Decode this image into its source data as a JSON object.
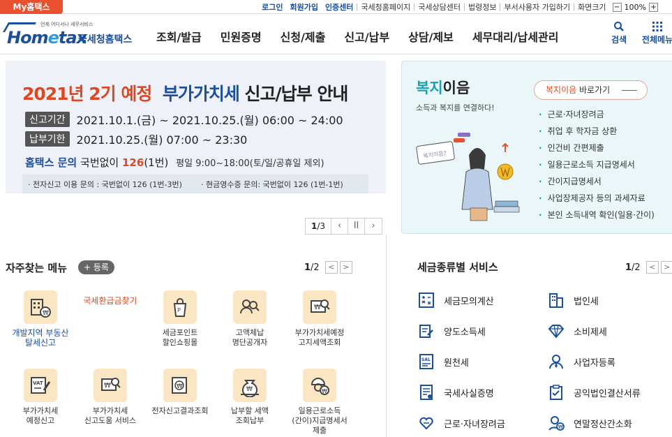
{
  "topbar": {
    "my_tab": "My홈택스",
    "links": [
      "로그인",
      "회원가입",
      "인증센터",
      "국세청홈페이지",
      "국세상담센터",
      "법령정보",
      "부서사용자 가입하기",
      "화면크기"
    ],
    "zoom_minus": "−",
    "zoom_value": "100%",
    "zoom_plus": "+"
  },
  "header": {
    "logo_tagline": "언제 어디서나 세무서비스",
    "logo_word_a": "Hom",
    "logo_word_e": "e",
    "logo_word_b": "tax",
    "logo_kr": "국세청홈택스",
    "nav": [
      "조회/발급",
      "민원증명",
      "신청/제출",
      "신고/납부",
      "상담/제보",
      "세무대리/납세관리"
    ],
    "search_label": "검색",
    "all_menu_label": "전체메뉴"
  },
  "hero": {
    "title_red": "2021년 2기 예정",
    "title_blue": "부가가치세",
    "title_dark": "신고/납부 안내",
    "period_label": "신고기간",
    "period_value": "2021.10.1.(금) ~ 2021.10.25.(월) 06:00 ~ 24:00",
    "due_label": "납부기한",
    "due_value": "2021.10.25.(월) 07:00 ~ 23:30",
    "ask_a": "홈택스 문의",
    "ask_b": "국번없이",
    "ask_num": "126",
    "ask_c": "(1번)",
    "ask_hours": "평일 9:00~18:00(토/일/공휴일 제외)",
    "note_1": "· 전자신고 이용 문의 : 국번없이 126 (1번-3번)",
    "note_2": "· 현금영수증 문의: 국번없이 126 (1번-1번)",
    "pager_current": "1",
    "pager_total": "/3",
    "pager_prev": "‹",
    "pager_pause": "II",
    "pager_next": "›"
  },
  "welfare": {
    "title_hl": "복지",
    "title_rest": "이음",
    "subtitle": "소득과 복지를 연결하다!",
    "go_hl": "복지이음",
    "go_rest": " 바로가기",
    "items": [
      "근로·자녀장려금",
      "취업 후 학자금 상환",
      "인건비 간편제출",
      "일용근로소득 지급명세서",
      "간이지급명세서",
      "사업장제공자 등의 과세자료",
      "본인 소득내역 확인(일용·간이)"
    ],
    "bubble_text": "복지이음?"
  },
  "favorites": {
    "title": "자주찾는 메뉴",
    "register": "+ 등록",
    "page_current": "1",
    "page_total": "/2",
    "items": [
      {
        "label": "개발지역 부동산\n탈세신고",
        "icon": "building-coin-icon"
      },
      {
        "label": "국세환급금찾기",
        "icon": "refund-icon"
      },
      {
        "label": "세금포인트\n할인쇼핑몰",
        "icon": "shopping-bag-icon"
      },
      {
        "label": "고액체납\n명단공개자",
        "icon": "people-search-icon"
      },
      {
        "label": "부가가치세예정\n고지세액조회",
        "icon": "won-search-icon"
      },
      {
        "label": "부가가치세\n예정신고",
        "icon": "vat-pen-icon"
      },
      {
        "label": "부가가치세\n신고도움 서비스",
        "icon": "won-doc-search-icon"
      },
      {
        "label": "전자신고결과조회",
        "icon": "won-doc-icon"
      },
      {
        "label": "납부할 세액\n조회납부",
        "icon": "money-bag-icon"
      },
      {
        "label": "일용근로소득\n(간이)지급명세서\n제출",
        "icon": "worker-coin-icon"
      }
    ]
  },
  "services": {
    "title": "세금종류별 서비스",
    "page_current": "1",
    "page_total": "/2",
    "items": [
      {
        "label": "세금모의계산",
        "icon": "calculator-icon"
      },
      {
        "label": "법인세",
        "icon": "corporate-building-icon"
      },
      {
        "label": "양도소득세",
        "icon": "transfer-doc-icon"
      },
      {
        "label": "소비제세",
        "icon": "diamond-icon"
      },
      {
        "label": "원천세",
        "icon": "salary-doc-icon"
      },
      {
        "label": "사업자등록",
        "icon": "business-person-icon"
      },
      {
        "label": "국세사실증명",
        "icon": "certificate-icon"
      },
      {
        "label": "공익법인결산서류",
        "icon": "checklist-icon"
      },
      {
        "label": "근로·자녀장려금",
        "icon": "heart-hand-icon"
      },
      {
        "label": "연말정산간소화",
        "icon": "person-won-icon"
      }
    ]
  },
  "colors": {
    "brand_blue": "#1a4fa0",
    "accent_red": "#e0461f",
    "welfare_teal": "#17a3ad",
    "tile_bg": "#fbe6c3"
  }
}
